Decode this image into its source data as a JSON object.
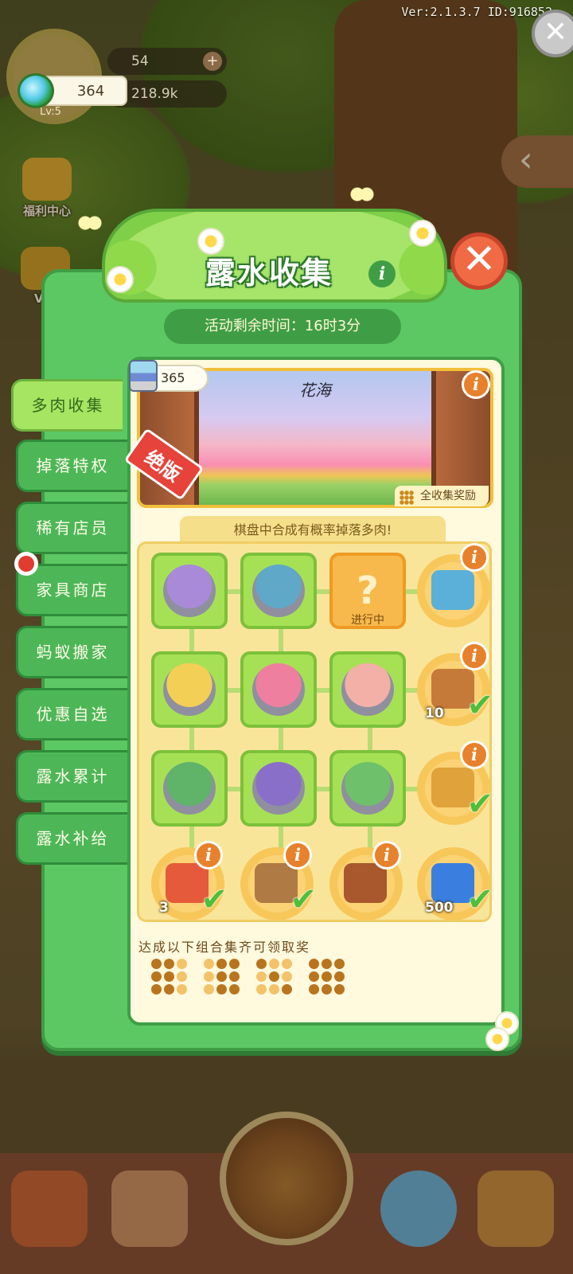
{
  "version_text": "Ver:2.1.3.7 ID:916852",
  "player": {
    "level": "Lv:5"
  },
  "resources": {
    "gems": "54",
    "coins": "218.9k",
    "dew": "364"
  },
  "side_icons": {
    "welfare": "福利中心",
    "vip": "VIP"
  },
  "popup": {
    "title": "露水收集",
    "timer": "活动剩余时间：16时3分",
    "tabs": [
      "多肉收集",
      "掉落特权",
      "稀有店员",
      "家具商店",
      "蚂蚁搬家",
      "优惠自选",
      "露水累计",
      "露水补给"
    ],
    "active_tab": 0,
    "scene": {
      "name": "花海",
      "dew_count": "365",
      "limited_badge": "绝版",
      "reward_label": "全收集奖励"
    },
    "hint": "棋盘中合成有概率掉落多肉!",
    "board": {
      "unknown_mark": "?",
      "in_progress": "进行中",
      "row_rewards": [
        {
          "name": "treasure-chest",
          "qty": "",
          "done": false,
          "color": "#5ab0d8"
        },
        {
          "name": "cat-bag",
          "qty": "10",
          "done": true,
          "color": "#c57a3a"
        },
        {
          "name": "blue-box",
          "qty": "",
          "done": true,
          "color": "#e0a23a"
        }
      ],
      "column_rewards": [
        {
          "name": "scissors",
          "qty": "3",
          "done": true,
          "color": "#e55a3a"
        },
        {
          "name": "sign-house",
          "qty": "",
          "done": true,
          "color": "#b07a44"
        },
        {
          "name": "wood-chest",
          "qty": "",
          "done": false,
          "color": "#a9572c"
        },
        {
          "name": "lightning",
          "qty": "500",
          "done": true,
          "color": "#3a7fe0"
        }
      ],
      "succulent_colors": [
        "#a88ad8",
        "#5fa8c8",
        "#e8a3c0",
        "#f4cf55",
        "#ef7f9f",
        "#f3b0a6",
        "#5fb46a",
        "#8a6fc8",
        "#6fc06a"
      ]
    },
    "combo_label": "达成以下组合集齐可领取奖",
    "combos": [
      [
        1,
        1,
        0,
        1,
        1,
        0,
        1,
        1,
        0
      ],
      [
        0,
        1,
        1,
        0,
        1,
        1,
        0,
        1,
        1
      ],
      [
        1,
        0,
        0,
        0,
        1,
        0,
        0,
        0,
        1
      ],
      [
        1,
        1,
        1,
        1,
        1,
        1,
        1,
        1,
        1
      ]
    ]
  }
}
